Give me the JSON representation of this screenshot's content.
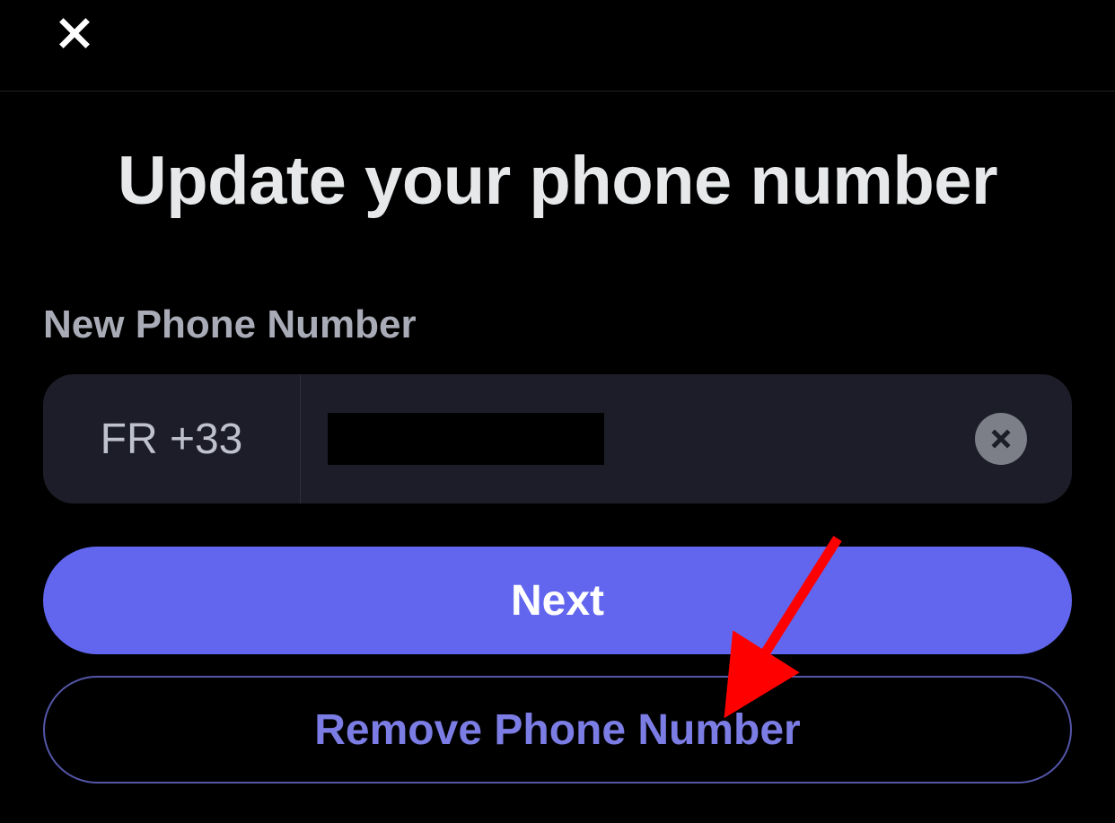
{
  "header": {},
  "page": {
    "title": "Update your phone number",
    "phone_section": {
      "label": "New Phone Number",
      "country_code": "FR +33",
      "value_redacted": true
    },
    "buttons": {
      "next": "Next",
      "remove": "Remove Phone Number"
    }
  },
  "annotation": {
    "type": "arrow",
    "color": "#ff0000",
    "target": "remove-button"
  }
}
